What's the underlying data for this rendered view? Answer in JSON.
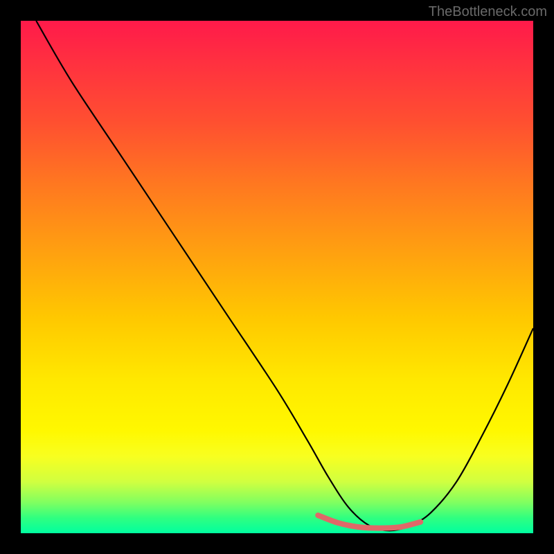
{
  "watermark": "TheBottleneck.com",
  "chart_data": {
    "type": "line",
    "title": "",
    "xlabel": "",
    "ylabel": "",
    "xlim": [
      0,
      100
    ],
    "ylim": [
      0,
      100
    ],
    "background_gradient": {
      "top": "#ff1a4a",
      "mid": "#ffe000",
      "bottom": "#00ffa0",
      "description": "vertical red-to-yellow-to-green gradient representing bottleneck severity"
    },
    "series": [
      {
        "name": "bottleneck-curve",
        "color": "#000000",
        "stroke_width": 2,
        "x": [
          3,
          10,
          20,
          30,
          40,
          50,
          56,
          60,
          64,
          68,
          72,
          76,
          80,
          85,
          90,
          95,
          100
        ],
        "values": [
          100,
          88,
          73,
          58,
          43,
          28,
          18,
          11,
          5,
          1.5,
          0.5,
          1.5,
          4,
          10,
          19,
          29,
          40
        ]
      },
      {
        "name": "optimal-band-marker",
        "color": "#e06868",
        "stroke_width": 8,
        "x": [
          58,
          62,
          66,
          70,
          74,
          78
        ],
        "values": [
          3.5,
          2.0,
          1.2,
          1.0,
          1.2,
          2.2
        ]
      }
    ],
    "annotations": [],
    "grid": false,
    "legend": false
  }
}
